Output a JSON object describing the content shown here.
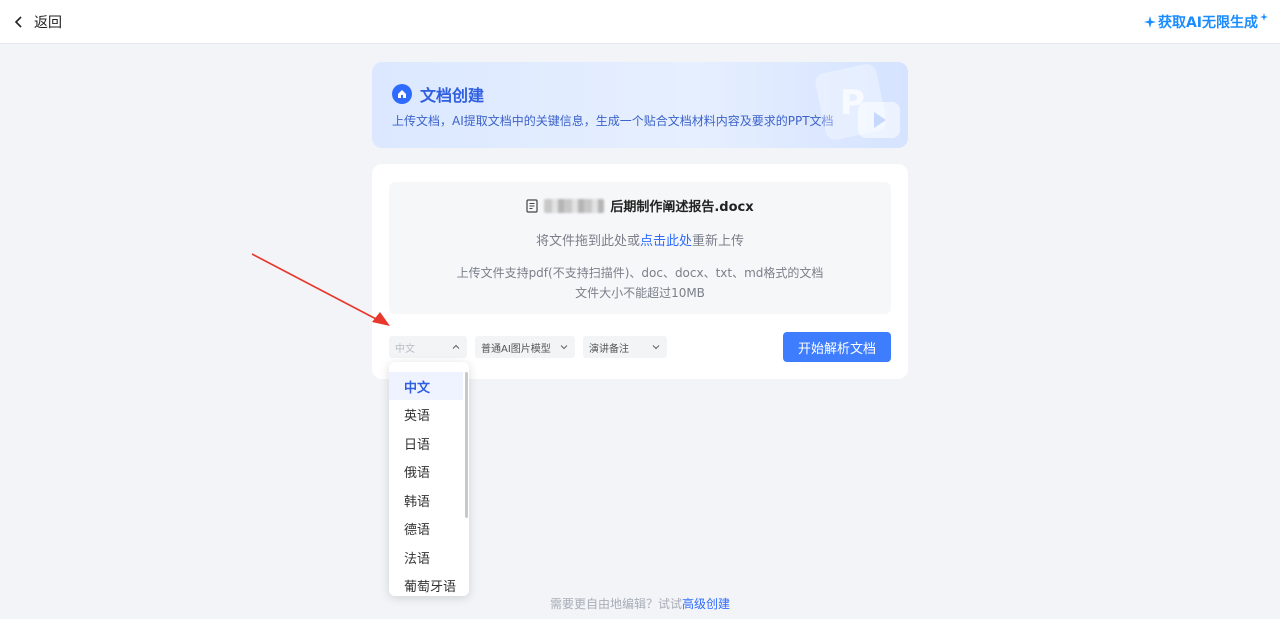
{
  "topbar": {
    "back_label": "返回",
    "promo_label": "获取AI无限生成"
  },
  "hero": {
    "title": "文档创建",
    "description": "上传文档，AI提取文档中的关键信息，生成一个贴合文档材料内容及要求的PPT文档"
  },
  "upload": {
    "file_name": "后期制作阐述报告.docx",
    "reupload_prefix": "将文件拖到此处或",
    "reupload_link": "点击此处",
    "reupload_suffix": "重新上传",
    "hint_formats": "上传文件支持pdf(不支持扫描件)、doc、docx、txt、md格式的文档",
    "hint_size": "文件大小不能超过10MB"
  },
  "controls": {
    "language_value": "中文",
    "model_value": "普通AI图片模型",
    "notes_value": "演讲备注",
    "start_button": "开始解析文档"
  },
  "language_dropdown": {
    "options": [
      "中文",
      "英语",
      "日语",
      "俄语",
      "韩语",
      "德语",
      "法语",
      "葡萄牙语"
    ],
    "selected": "中文"
  },
  "footer": {
    "prefix": "需要更自由地编辑？试试",
    "link": "高级创建"
  },
  "colors": {
    "accent": "#3f7dff",
    "promo": "#1a8cff",
    "arrow": "#e8372c"
  }
}
